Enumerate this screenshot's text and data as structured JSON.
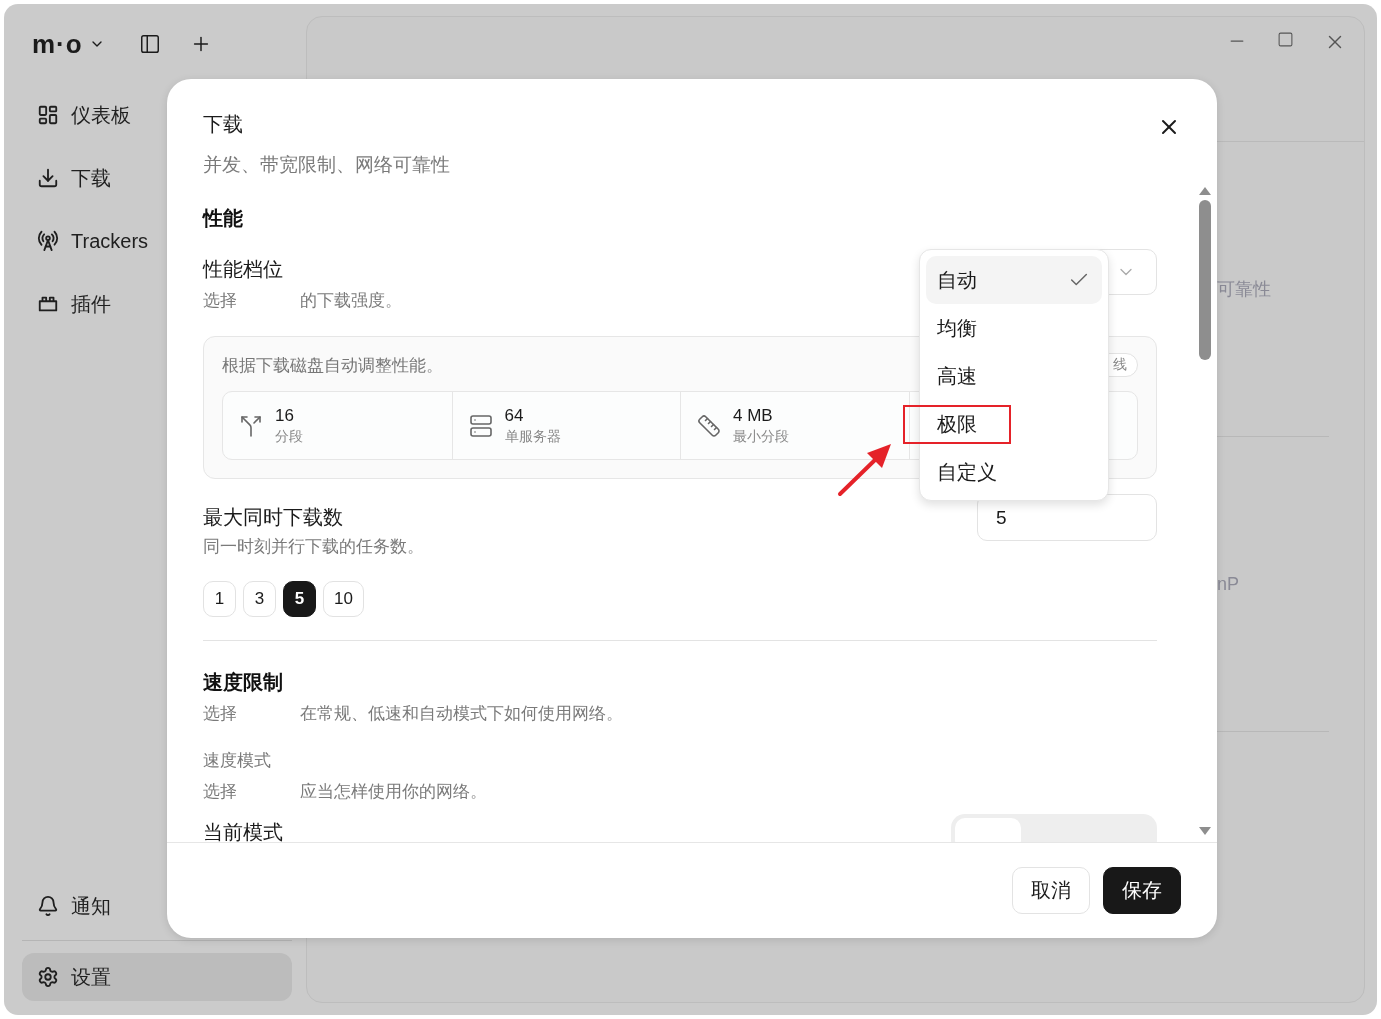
{
  "app": {
    "brand": "m·o"
  },
  "sidebar": {
    "items": [
      {
        "label": "仪表板",
        "selected": false
      },
      {
        "label": "下载",
        "selected": false
      },
      {
        "label": "Trackers",
        "selected": false
      },
      {
        "label": "插件",
        "selected": false
      }
    ],
    "bottom_items": [
      {
        "label": "通知",
        "selected": false
      },
      {
        "label": "设置",
        "selected": true
      }
    ]
  },
  "background": {
    "texts": [
      "可靠性",
      "nP"
    ]
  },
  "dialog": {
    "title": "下载",
    "subtitle": "并发、带宽限制、网络可靠性",
    "performance": {
      "heading": "性能",
      "label": "性能档位",
      "description": [
        "选择",
        "的下载强度。"
      ],
      "card": {
        "text": "根据下载磁盘自动调整性能。",
        "badge": "线",
        "stats": [
          {
            "value": "16",
            "label": "分段"
          },
          {
            "value": "64",
            "label": "单服务器"
          },
          {
            "value": "4 MB",
            "label": "最小分段"
          }
        ]
      }
    },
    "concurrency": {
      "label": "最大同时下载数",
      "description": "同一时刻并行下载的任务数。",
      "value": "5",
      "presets": [
        {
          "label": "1",
          "selected": false
        },
        {
          "label": "3",
          "selected": false
        },
        {
          "label": "5",
          "selected": true
        },
        {
          "label": "10",
          "selected": false
        }
      ]
    },
    "speed": {
      "heading": "速度限制",
      "description": [
        "选择",
        "在常规、低速和自动模式下如何使用网络。"
      ],
      "mode_label": "速度模式",
      "mode_description": [
        "选择",
        "应当怎样使用你的网络。"
      ],
      "current_label": "当前模式"
    },
    "footer": {
      "cancel": "取消",
      "save": "保存"
    }
  },
  "dropdown": {
    "options": [
      {
        "label": "自动",
        "selected": true,
        "highlighted": false
      },
      {
        "label": "均衡",
        "selected": false,
        "highlighted": false
      },
      {
        "label": "高速",
        "selected": false,
        "highlighted": false
      },
      {
        "label": "极限",
        "selected": false,
        "highlighted": true
      },
      {
        "label": "自定义",
        "selected": false,
        "highlighted": false
      }
    ]
  }
}
